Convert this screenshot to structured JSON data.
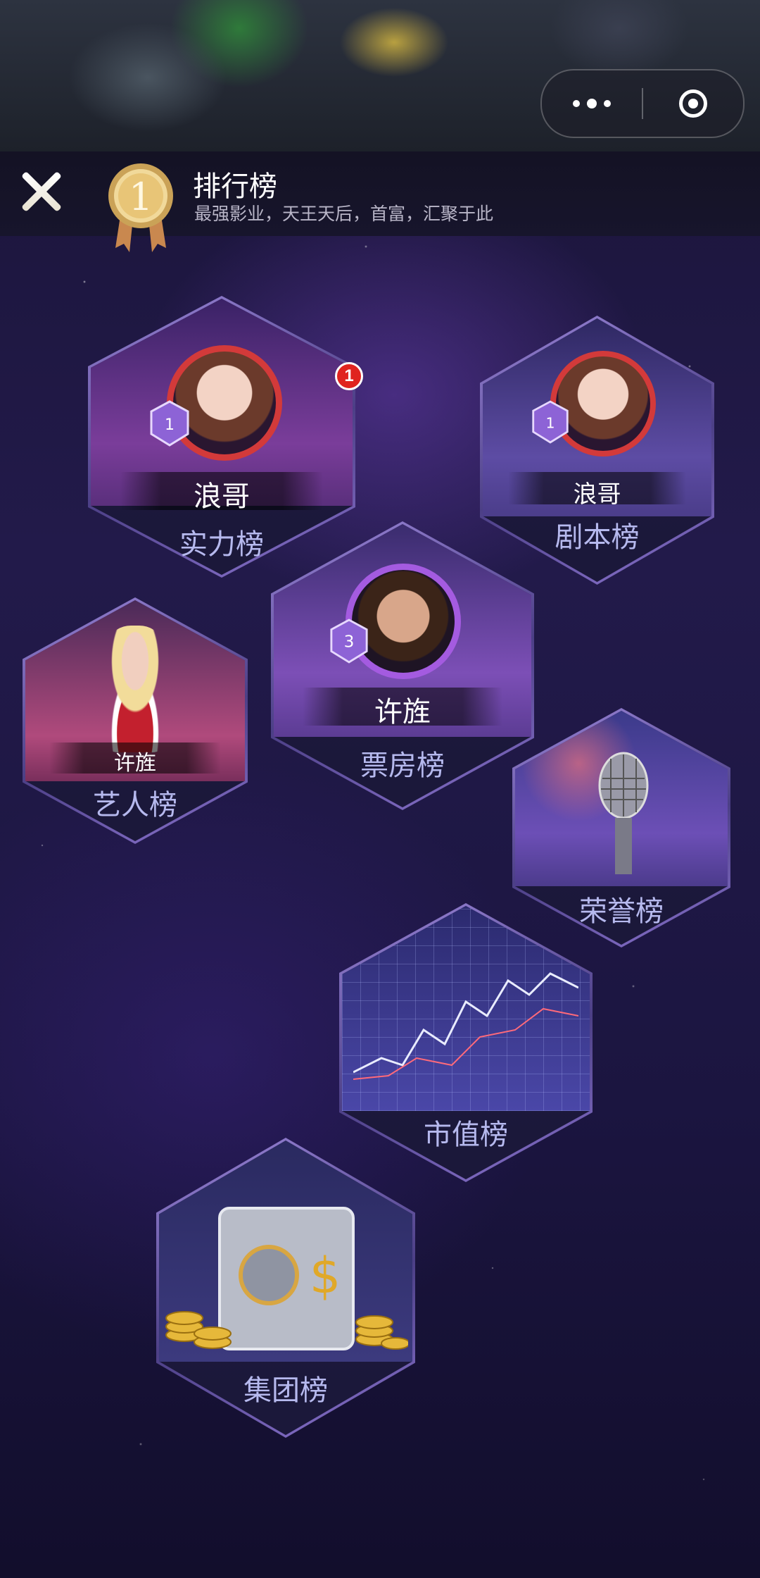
{
  "capsule": {
    "more_icon": "more-dots-icon",
    "close_icon": "target-circle-icon"
  },
  "header": {
    "title": "排行榜",
    "subtitle": "最强影业，天王天后，首富，汇聚于此",
    "close_icon": "close-icon",
    "medal_icon": "gold-medal-icon",
    "medal_number": "1"
  },
  "boards": {
    "power": {
      "title": "实力榜",
      "holder": "浪哥",
      "badge_count": "1",
      "rank_badge": "1"
    },
    "script": {
      "title": "剧本榜",
      "holder": "浪哥",
      "rank_badge": "1"
    },
    "box_office": {
      "title": "票房榜",
      "holder": "许旌",
      "rank_badge": "3"
    },
    "artist": {
      "title": "艺人榜",
      "holder": "许旌"
    },
    "honor": {
      "title": "荣誉榜"
    },
    "market_value": {
      "title": "市值榜"
    },
    "group": {
      "title": "集团榜"
    }
  },
  "colors": {
    "accent_text": "#b6b9ee",
    "hex_border": "#9b86d9",
    "notif": "#e0241f"
  }
}
